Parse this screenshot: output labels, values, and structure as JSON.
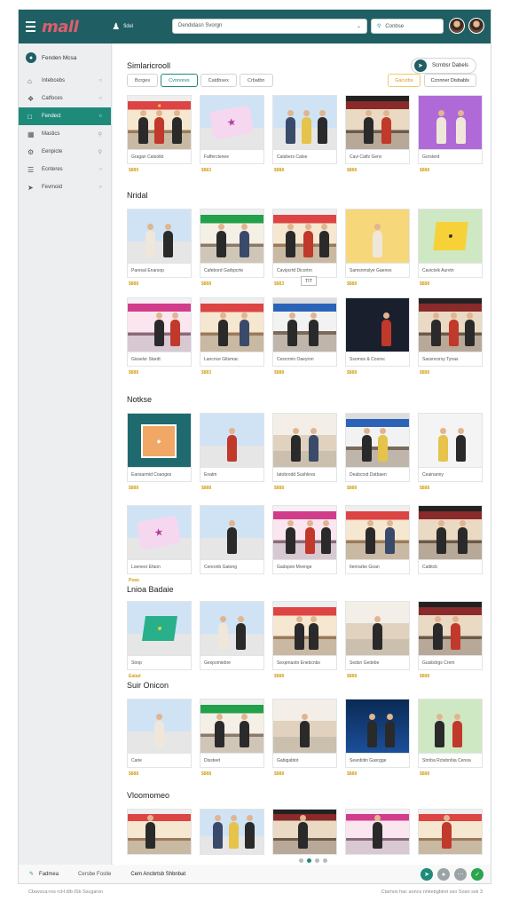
{
  "app": {
    "logo": "mall",
    "menu_icon": "hamburger-icon",
    "user_icon": "user-icon",
    "user_label": "fidel"
  },
  "search": {
    "value": "Dendidasn Svorgn",
    "placeholder": "Conbse"
  },
  "sidebar": {
    "header": "Fenden Mcsa",
    "items": [
      {
        "label": "Intebcebs",
        "icon": "store-icon"
      },
      {
        "label": "Catfoces",
        "icon": "tag-icon"
      },
      {
        "label": "Fendect",
        "icon": "bag-icon",
        "active": true
      },
      {
        "label": "Mastics",
        "icon": "grid-icon"
      },
      {
        "label": "Eenpicte",
        "icon": "settings-icon"
      },
      {
        "label": "Ecnteres",
        "icon": "list-icon"
      },
      {
        "label": "Fevmoid",
        "icon": "pin-icon"
      }
    ]
  },
  "main": {
    "title": "Simlaricrooll",
    "top_button": "Scrnbsr Dabels",
    "filters": [
      "Bcrges",
      "Cvnnores",
      "Catdbsex",
      "Crbatbn"
    ],
    "right_filters": [
      "Gacutbs",
      "Ccnnner Disbabls"
    ],
    "sections": [
      {
        "title": "",
        "rows": [
          [
            {
              "caption": "Gragan Catsotkt",
              "price": "$889"
            },
            {
              "caption": "Fafferctenee",
              "price": "$883"
            },
            {
              "caption": "Catsbers Catse",
              "price": "$888"
            },
            {
              "caption": "Cavi Catfs Genv",
              "price": "$888"
            },
            {
              "caption": "Gorsterd",
              "price": "$888"
            }
          ]
        ]
      },
      {
        "title": "Nridal",
        "rows": [
          [
            {
              "caption": "Paresal Enarsop",
              "price": "$888"
            },
            {
              "caption": "Cafebord Garbpcrte",
              "price": "$888"
            },
            {
              "caption": "Cavipcrtd Dicortrn",
              "price": "$883"
            },
            {
              "caption": "Samsnmslye Gaenes",
              "price": "$888"
            },
            {
              "caption": "Cavictvik Aurvtn",
              "price": "$888"
            }
          ],
          [
            {
              "caption": "Gisselsr Stardt",
              "price": "$888"
            },
            {
              "caption": "Lancnce Gitsmac",
              "price": "$883"
            },
            {
              "caption": "Cesrcmin Oaeyron",
              "price": "$888"
            },
            {
              "caption": "Ssomos & Coorsc",
              "price": "$888"
            },
            {
              "caption": "Sassncorsy Tynas",
              "price": "$888"
            }
          ]
        ]
      },
      {
        "title": "Notkse",
        "rows": [
          [
            {
              "caption": "Eansarmid Coaoges",
              "price": "$888"
            },
            {
              "caption": "Enatm",
              "price": "$888"
            },
            {
              "caption": "Iatobrodd Sushkres",
              "price": "$888"
            },
            {
              "caption": "Deabcrsd Datbaen",
              "price": "$888"
            },
            {
              "caption": "Ceainanny",
              "price": "$888"
            }
          ],
          [
            {
              "caption": "Loeneor Efaon",
              "price": "Pean"
            },
            {
              "caption": "Cereonb Gatong",
              "price": ""
            },
            {
              "caption": "Gadspon Mvenge",
              "price": ""
            },
            {
              "caption": "Iterirarbe Goan",
              "price": ""
            },
            {
              "caption": "Cattitcb",
              "price": ""
            }
          ]
        ]
      },
      {
        "title": "Lnioa Badaie",
        "rows": [
          [
            {
              "caption": "Strop",
              "price": "Eatad"
            },
            {
              "caption": "Gexpomiebre",
              "price": ""
            },
            {
              "caption": "Sexpmaotn Enebcnbs",
              "price": "$888"
            },
            {
              "caption": "Sedsn Gedebe",
              "price": "$888"
            },
            {
              "caption": "Guisbdrgs Crem",
              "price": "$888"
            }
          ]
        ]
      },
      {
        "title": "Suir Onicon",
        "rows": [
          [
            {
              "caption": "Carie",
              "price": "$888"
            },
            {
              "caption": "Dissteet",
              "price": "$888"
            },
            {
              "caption": "Gabigabtot",
              "price": "$888"
            },
            {
              "caption": "Seanbitin Gasrgge",
              "price": "$888"
            },
            {
              "caption": "Strnba Rctebnbia Cenoa",
              "price": "$888"
            }
          ]
        ]
      },
      {
        "title": "Vloomomeo",
        "rows": []
      }
    ],
    "tooltip": "TIT"
  },
  "footer": {
    "label1": "Fadmea",
    "label2": "Cersbe Fostle",
    "label3": "Cem Ancbrtsb Shbnbat"
  },
  "copyright": {
    "left": "Cbavsca-ros rcH dib tSb Sscgarsn",
    "right": "Ctamos hac aoncs nnkebgbirei sso Soan ssk 3"
  }
}
